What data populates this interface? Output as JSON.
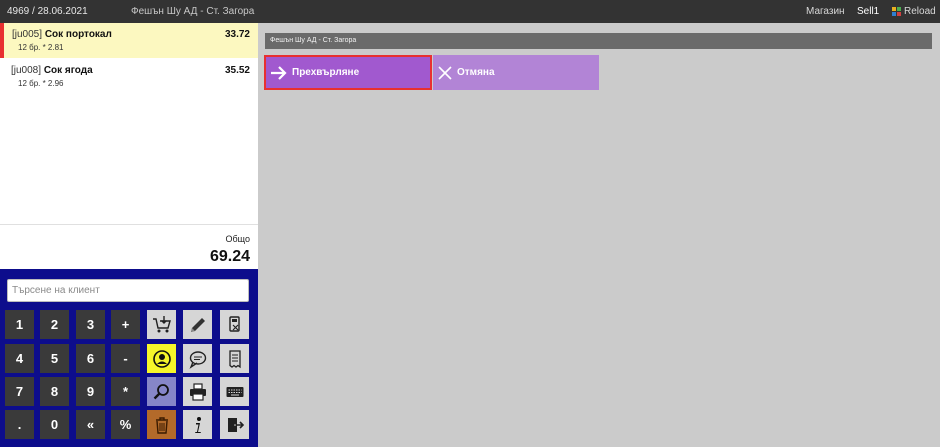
{
  "topbar": {
    "doc": "4969 / 28.06.2021",
    "company": "Фешън Шу АД - Ст. Загора",
    "store": "Магазин",
    "user": "Sell1",
    "reload": "Reload"
  },
  "items": [
    {
      "code": "[ju005]",
      "name": "Сок портокал",
      "qty": "12 бр. * 2.81",
      "total": "33.72",
      "selected": true
    },
    {
      "code": "[ju008]",
      "name": "Сок ягода",
      "qty": "12 бр. * 2.96",
      "total": "35.52",
      "selected": false
    }
  ],
  "totals": {
    "label": "Общо",
    "value": "69.24"
  },
  "search": {
    "placeholder": "Търсене на клиент"
  },
  "keys": {
    "row1": [
      "1",
      "2",
      "3",
      "+"
    ],
    "row2": [
      "4",
      "5",
      "6",
      "-"
    ],
    "row3": [
      "7",
      "8",
      "9",
      "*"
    ],
    "row4": [
      ".",
      "0",
      "«",
      "%"
    ]
  },
  "fn_icons": [
    "cart-add-icon",
    "pencil-icon",
    "cash-register-icon",
    "customer-icon",
    "comment-icon",
    "receipt-icon",
    "zoom-icon",
    "printer-icon",
    "keyboard-icon",
    "trash-icon",
    "info-icon",
    "exit-icon"
  ],
  "main": {
    "header": "Фешън Шу АД - Ст. Загора",
    "transfer_label": "Прехвърляне",
    "cancel_label": "Отмяна"
  },
  "colors": {
    "topbar": "#333333",
    "pad": "#0d0d8c",
    "selected_item": "#fcf8c0",
    "accent_red": "#e83030",
    "transfer": "#a159cf",
    "cancel": "#b284d6",
    "yellow_key": "#f6f62a"
  }
}
